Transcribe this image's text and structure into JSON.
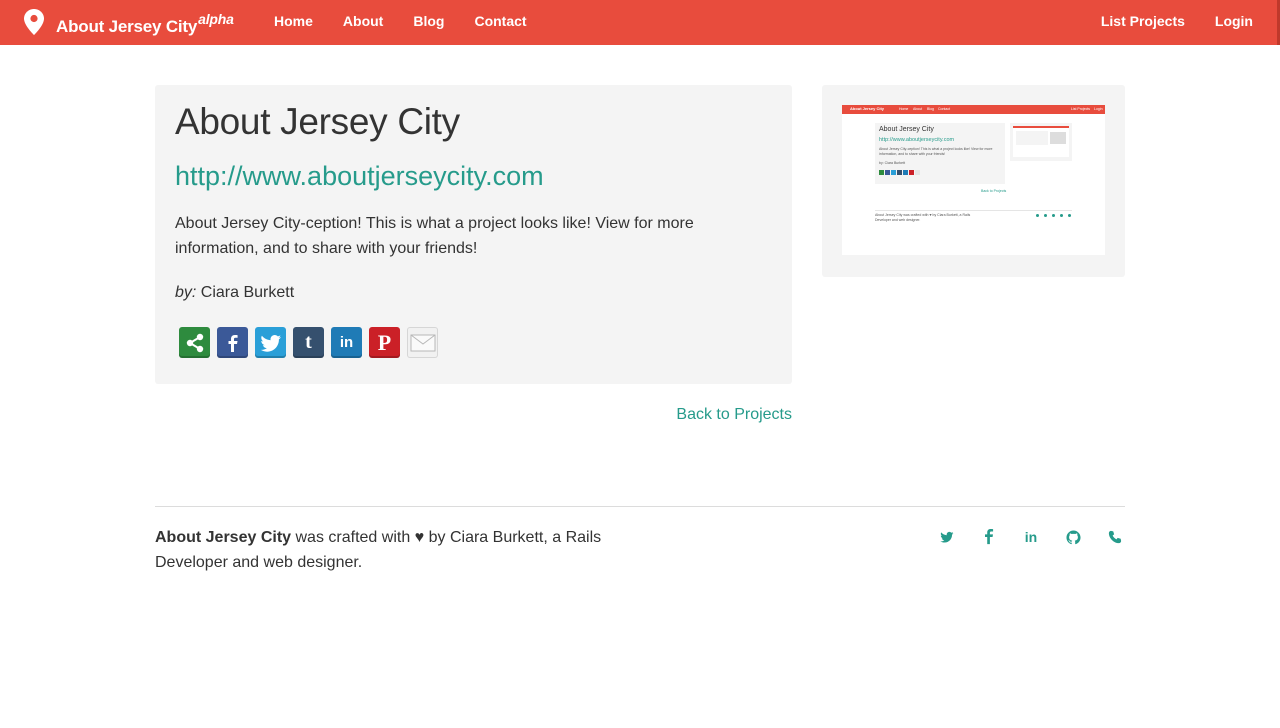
{
  "navbar": {
    "brand": "About Jersey City",
    "brand_sup": "alpha",
    "links_left": [
      "Home",
      "About",
      "Blog",
      "Contact"
    ],
    "links_right": [
      "List Projects",
      "Login"
    ],
    "color": "#e84c3d"
  },
  "project": {
    "title": "About Jersey City",
    "url": "http://www.aboutjerseycity.com",
    "description": "About Jersey City-ception! This is what a project looks like! View for more information, and to share with your friends!",
    "by_label": "by:",
    "author": "Ciara Burkett",
    "share_icons": [
      "share-icon",
      "facebook-icon",
      "twitter-icon",
      "tumblr-icon",
      "linkedin-icon",
      "pinterest-icon",
      "email-icon"
    ]
  },
  "back_link": "Back to Projects",
  "thumbnail": {
    "brand": "About Jersey City",
    "nav": [
      "Home",
      "About",
      "Blog",
      "Contact"
    ],
    "nav_right": [
      "List Projects",
      "Login"
    ],
    "title": "About Jersey City",
    "url": "http://www.aboutjerseycity.com",
    "description": "About Jersey City-ception! This is what a project looks like! View for more information, and to share with your friends!",
    "by": "by: Ciara Burkett",
    "back": "Back to Projects",
    "footer": "About Jersey City was crafted with ♥ by Ciara Burkett, a Rails Developer and web designer."
  },
  "footer": {
    "brand": "About Jersey City",
    "text": "was crafted with",
    "heart": "♥",
    "text_after": "by Ciara Burkett, a Rails Developer and web designer.",
    "icons": [
      "twitter-icon",
      "facebook-icon",
      "linkedin-icon",
      "github-icon",
      "phone-icon"
    ]
  },
  "colors": {
    "accent": "#269b8b",
    "panel": "#f4f4f4"
  }
}
